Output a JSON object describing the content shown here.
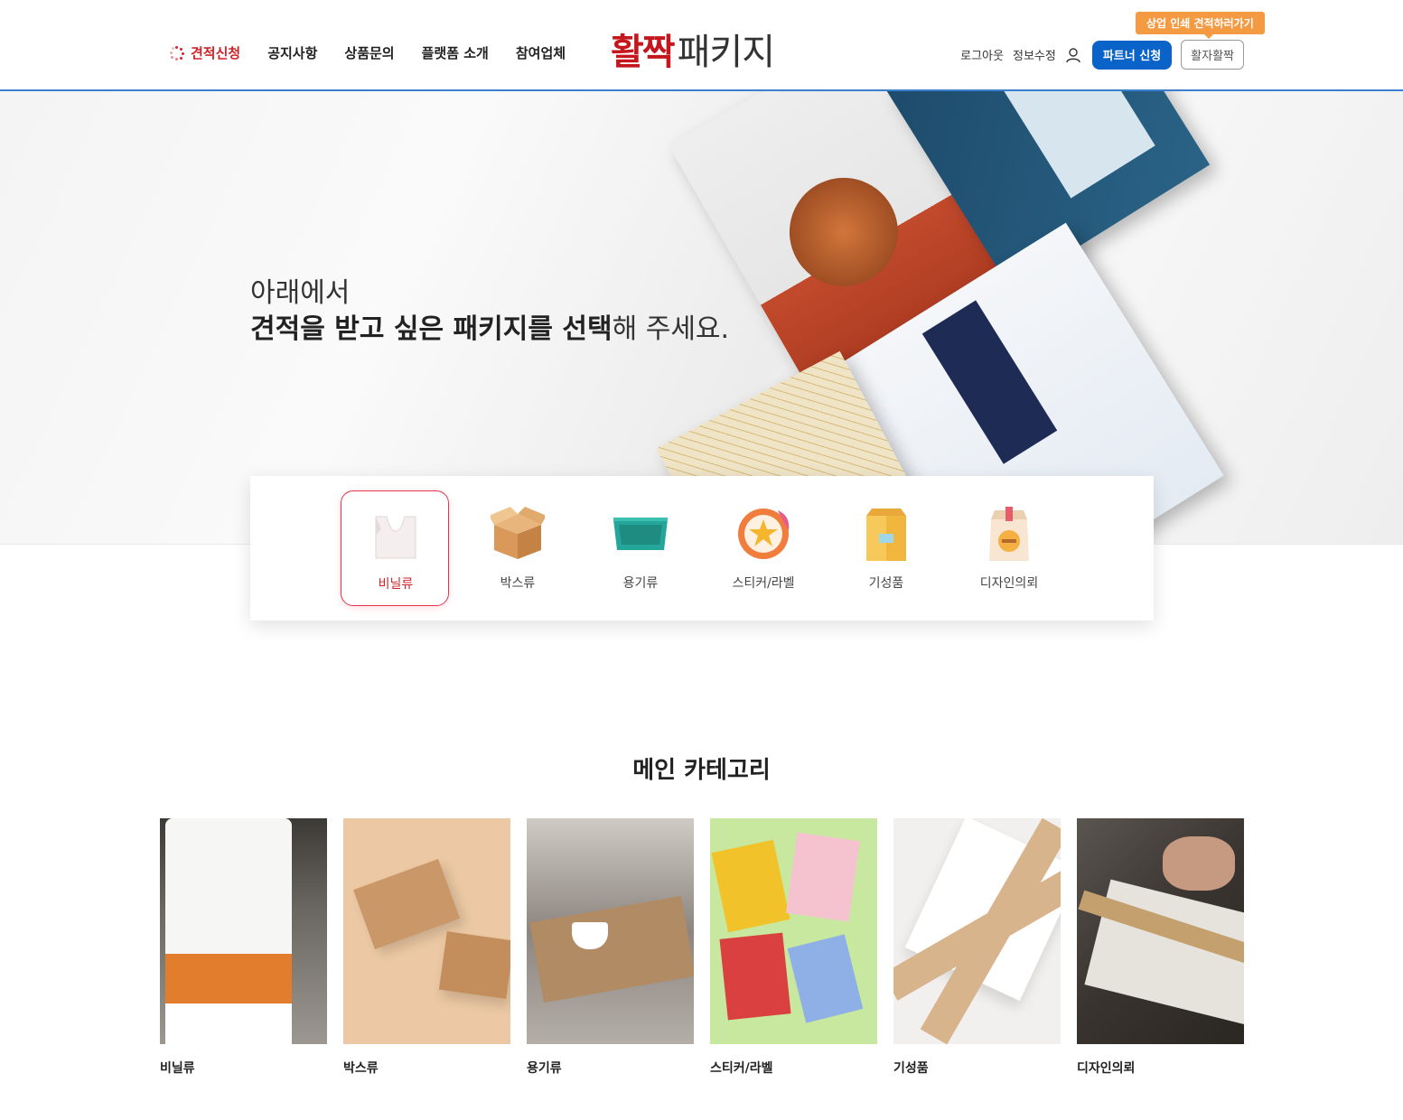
{
  "header": {
    "nav": [
      {
        "label": "견적신청",
        "active": true
      },
      {
        "label": "공지사항"
      },
      {
        "label": "상품문의"
      },
      {
        "label": "플랫폼 소개"
      },
      {
        "label": "참여업체"
      }
    ],
    "logo": {
      "part1": "활짝",
      "part2": "패키지"
    },
    "util": {
      "logout": "로그아웃",
      "edit_info": "정보수정",
      "partner_btn": "파트너 신청",
      "brand_btn": "활자활짝",
      "tooltip": "상업 인쇄 견적하러가기"
    },
    "accent_color": "#0a63c9",
    "brand_color": "#c4161c"
  },
  "hero": {
    "line1": "아래에서",
    "line2_bold": "견적을 받고 싶은 패키지를 선택",
    "line2_rest": "해 주세요."
  },
  "selector": {
    "items": [
      {
        "label": "비닐류",
        "icon": "vinyl-bag-icon",
        "active": true
      },
      {
        "label": "박스류",
        "icon": "box-icon"
      },
      {
        "label": "용기류",
        "icon": "container-tray-icon"
      },
      {
        "label": "스티커/라벨",
        "icon": "sticker-label-icon"
      },
      {
        "label": "기성품",
        "icon": "ready-made-bag-icon"
      },
      {
        "label": "디자인의뢰",
        "icon": "design-request-icon"
      }
    ]
  },
  "main_category": {
    "title": "메인 카테고리",
    "cards": [
      {
        "label": "비닐류"
      },
      {
        "label": "박스류"
      },
      {
        "label": "용기류"
      },
      {
        "label": "스티커/라벨"
      },
      {
        "label": "기성품"
      },
      {
        "label": "디자인의뢰"
      }
    ]
  }
}
